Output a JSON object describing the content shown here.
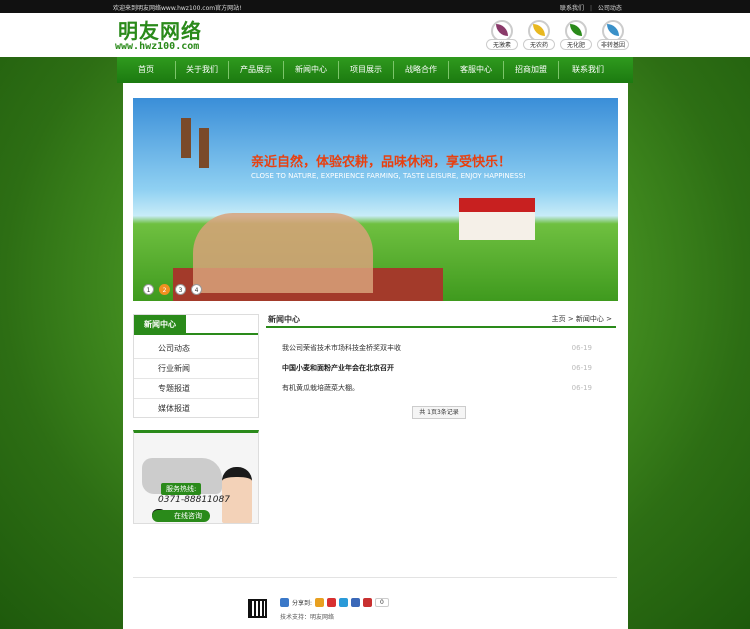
{
  "topbar": {
    "welcome": "欢迎来到明友网络www.hwz100.com官方网站!",
    "links": [
      "联系我们",
      "公司动态"
    ]
  },
  "header": {
    "logo_text": "明友网络",
    "logo_url": "www.hwz100.com",
    "badges": [
      {
        "label": "无激素",
        "color": "#8a3a6a"
      },
      {
        "label": "无农药",
        "color": "#e8b820"
      },
      {
        "label": "无化肥",
        "color": "#2a8a1a"
      },
      {
        "label": "非转基因",
        "color": "#3a90c8"
      }
    ]
  },
  "nav": [
    "首页",
    "关于我们",
    "产品展示",
    "新闻中心",
    "项目展示",
    "战略合作",
    "客服中心",
    "招商加盟",
    "联系我们"
  ],
  "banner": {
    "slogan_cn": "亲近自然，体验农耕，品味休闲，享受快乐！",
    "slogan_en": "CLOSE TO NATURE, EXPERIENCE FARMING, TASTE LEISURE, ENJOY HAPPINESS!",
    "slides": [
      "1",
      "2",
      "3",
      "4"
    ],
    "active_slide": 2
  },
  "sidebar": {
    "title": "新闻中心",
    "items": [
      "公司动态",
      "行业新闻",
      "专题报道",
      "媒体报道"
    ]
  },
  "contact": {
    "hotline_label": "服务热线:",
    "phone": "0371-88811087",
    "online_label": "在线咨询"
  },
  "main": {
    "title": "新闻中心",
    "breadcrumb": "主页 > 新闻中心 >",
    "news": [
      {
        "title": "我公司荣省技术市场科技金桥奖双丰收",
        "date": "06-19",
        "bold": false
      },
      {
        "title": "中国小麦和面粉产业年会在北京召开",
        "date": "06-19",
        "bold": true
      },
      {
        "title": "有机黄瓜栽培蔬菜大棚。",
        "date": "06-19",
        "bold": false
      }
    ],
    "pager": "共 1页3条记录"
  },
  "footer": {
    "share_label": "分享到:",
    "share_count": "0",
    "tech": "技术支持：明友网络"
  }
}
